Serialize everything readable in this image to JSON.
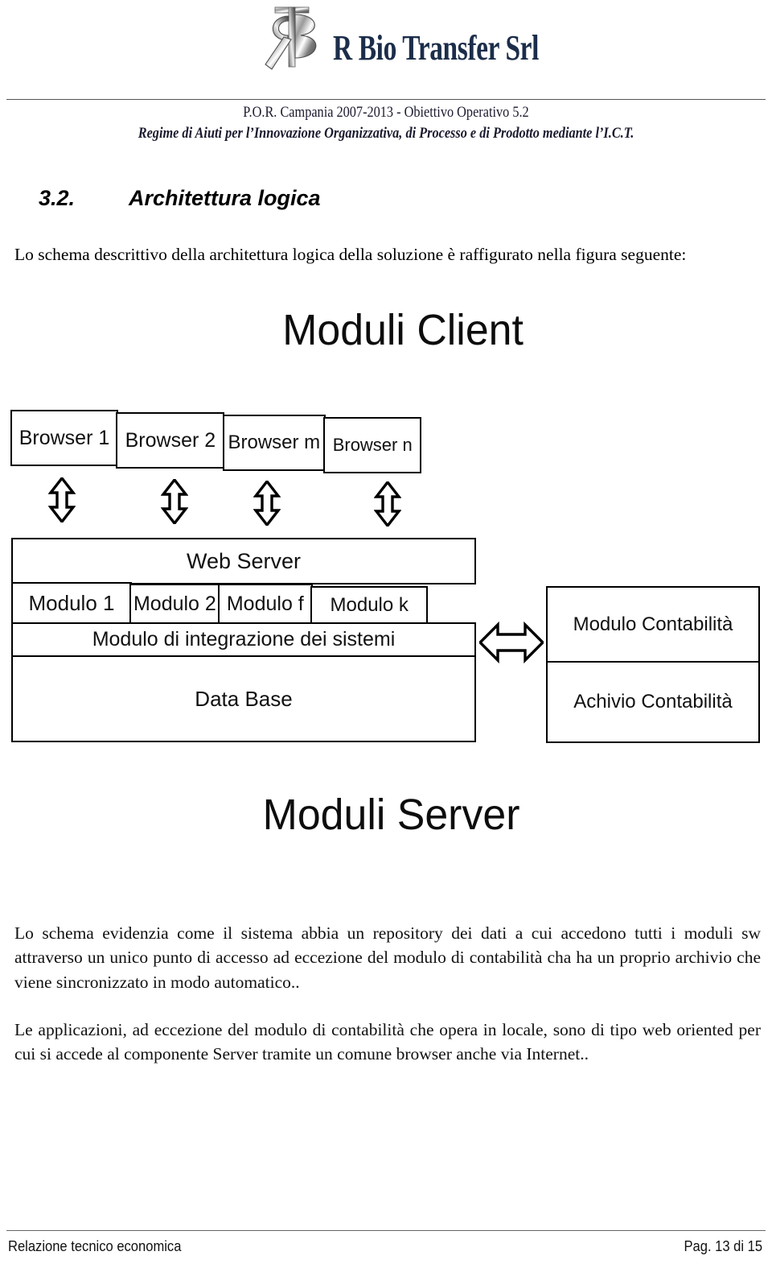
{
  "header": {
    "logo_text": "R Bio Transfer Srl",
    "logo_mark_icon": "rb-monogram-icon",
    "line1": "P.O.R. Campania 2007-2013 - Obiettivo Operativo 5.2",
    "line2": "Regime di Aiuti per l’Innovazione Organizzativa, di Processo e  di Prodotto mediante l’I.C.T."
  },
  "section": {
    "number": "3.2.",
    "title": "Architettura logica",
    "intro": "Lo schema descrittivo della architettura logica della soluzione è raffigurato nella figura seguente:"
  },
  "diagram": {
    "client_title": "Moduli Client",
    "server_title": "Moduli Server",
    "browsers": [
      {
        "label": "Browser 1"
      },
      {
        "label": "Browser 2"
      },
      {
        "label": "Browser m"
      },
      {
        "label": "Browser n"
      }
    ],
    "web_server": "Web Server",
    "moduli": [
      {
        "label": "Modulo 1"
      },
      {
        "label": "Modulo 2"
      },
      {
        "label": "Modulo  f"
      },
      {
        "label": "Modulo k"
      }
    ],
    "integrazione": "Modulo di integrazione dei sistemi",
    "database": "Data Base",
    "contabilita": {
      "modulo": "Modulo Contabilità",
      "archivio": "Achivio Contabilità"
    },
    "arrows": {
      "vertical_icon": "double-arrow-vertical-icon",
      "horizontal_icon": "double-arrow-horizontal-icon",
      "vertical_count": 4,
      "horizontal_count": 1
    }
  },
  "body": {
    "paragraph1": "Lo schema evidenzia come il sistema abbia un repository dei dati a cui accedono tutti i moduli sw attraverso un unico punto di accesso ad eccezione del modulo di contabilità cha ha un proprio archivio che viene sincronizzato in modo automatico..",
    "paragraph2": "Le applicazioni, ad eccezione del modulo di contabilità che opera in locale, sono di tipo web oriented per cui si accede al componente Server tramite un comune browser anche via Internet.."
  },
  "footer": {
    "left": "Relazione tecnico economica",
    "right": "Pag. 13 di 15"
  },
  "colors": {
    "logo_navy": "#1b2d4a",
    "header_text": "#1a1a2e",
    "rule": "#555555",
    "diagram_stroke": "#000000"
  }
}
